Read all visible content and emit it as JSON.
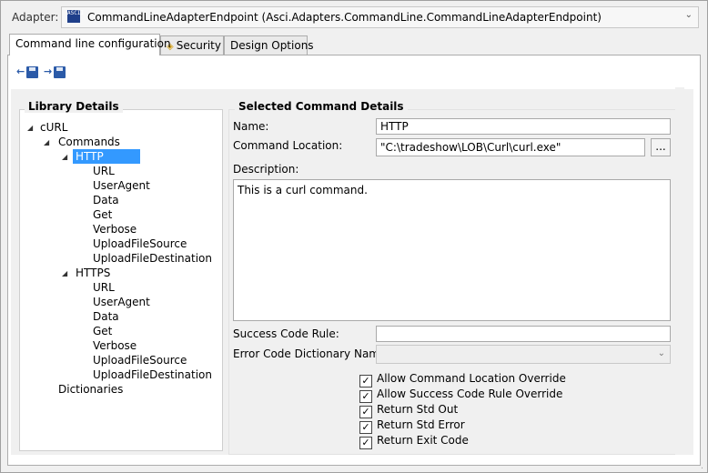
{
  "adapter": {
    "label": "Adapter:",
    "value": "CommandLineAdapterEndpoint (Asci.Adapters.CommandLine.CommandLineAdapterEndpoint)",
    "icon_text": "ASCII"
  },
  "tabs": [
    {
      "label": "Command line configuration",
      "active": true
    },
    {
      "label": "Security",
      "icon": "key-icon"
    },
    {
      "label": "Design Options"
    }
  ],
  "library": {
    "title": "Library Details",
    "root": "cURL",
    "commands_label": "Commands",
    "http": {
      "label": "HTTP",
      "children": [
        "URL",
        "UserAgent",
        "Data",
        "Get",
        "Verbose",
        "UploadFileSource",
        "UploadFileDestination"
      ]
    },
    "https": {
      "label": "HTTPS",
      "children": [
        "URL",
        "UserAgent",
        "Data",
        "Get",
        "Verbose",
        "UploadFileSource",
        "UploadFileDestination"
      ]
    },
    "dictionaries_label": "Dictionaries"
  },
  "details": {
    "title": "Selected Command Details",
    "name_label": "Name:",
    "name_value": "HTTP",
    "location_label": "Command Location:",
    "location_value": "\"C:\\tradeshow\\LOB\\Curl\\curl.exe\"",
    "browse_label": "...",
    "description_label": "Description:",
    "description_value": "This is a curl command.",
    "success_label": "Success Code Rule:",
    "success_value": "",
    "error_dict_label": "Error Code Dictionary Name:",
    "error_dict_value": ""
  },
  "checkboxes": [
    {
      "label": "Allow Command Location Override",
      "checked": true
    },
    {
      "label": "Allow Success Code Rule Override",
      "checked": true
    },
    {
      "label": "Return Std Out",
      "checked": true
    },
    {
      "label": "Return Std Error",
      "checked": true
    },
    {
      "label": "Return Exit Code",
      "checked": true
    }
  ]
}
